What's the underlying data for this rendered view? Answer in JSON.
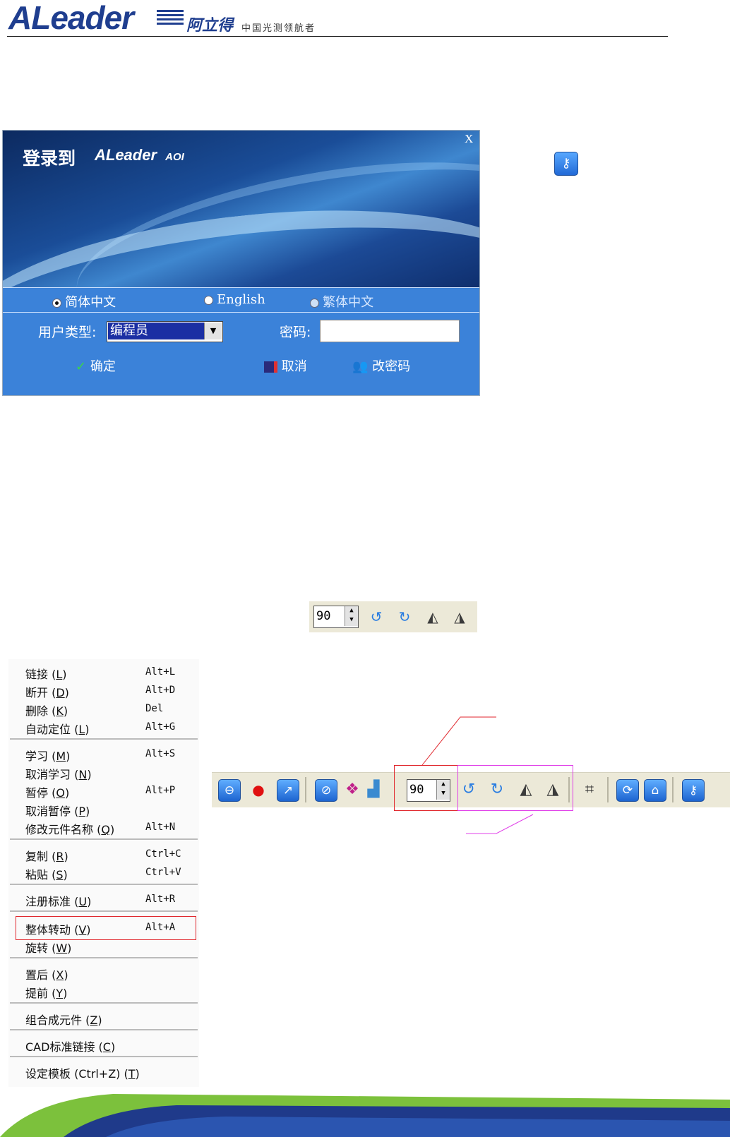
{
  "header": {
    "logo_text": "ALeader",
    "logo_cn": "阿立得",
    "tagline": "中国光测领航者"
  },
  "login_dialog": {
    "title": "登录到",
    "brand": "ALeader",
    "brand_suffix": "AOI",
    "close_label": "X",
    "languages": [
      {
        "label": "简体中文",
        "selected": true
      },
      {
        "label": "English",
        "selected": false
      },
      {
        "label": "繁体中文",
        "selected": false
      }
    ],
    "user_type_label": "用户类型:",
    "user_type_value": "编程员",
    "password_label": "密码:",
    "password_value": "",
    "ok_label": "确定",
    "cancel_label": "取消",
    "change_password_label": "改密码"
  },
  "small_toolbar": {
    "angle_value": "90"
  },
  "context_menu": {
    "items": [
      {
        "label": "链接",
        "key": "L",
        "shortcut": "Alt+L"
      },
      {
        "label": "断开",
        "key": "D",
        "shortcut": "Alt+D"
      },
      {
        "label": "删除",
        "key": "K",
        "shortcut": "Del"
      },
      {
        "label": "自动定位",
        "key": "L",
        "shortcut": "Alt+G"
      },
      {
        "label": "学习",
        "key": "M",
        "shortcut": "Alt+S"
      },
      {
        "label": "取消学习",
        "key": "N",
        "shortcut": ""
      },
      {
        "label": "暂停",
        "key": "O",
        "shortcut": "Alt+P"
      },
      {
        "label": "取消暂停",
        "key": "P",
        "shortcut": ""
      },
      {
        "label": "修改元件名称",
        "key": "Q",
        "shortcut": "Alt+N"
      },
      {
        "label": "复制",
        "key": "R",
        "shortcut": "Ctrl+C"
      },
      {
        "label": "粘贴",
        "key": "S",
        "shortcut": "Ctrl+V"
      },
      {
        "label": "注册标准",
        "key": "U",
        "shortcut": "Alt+R"
      },
      {
        "label": "整体转动",
        "key": "V",
        "shortcut": "Alt+A"
      },
      {
        "label": "旋转",
        "key": "W",
        "shortcut": ""
      },
      {
        "label": "置后",
        "key": "X",
        "shortcut": ""
      },
      {
        "label": "提前",
        "key": "Y",
        "shortcut": ""
      },
      {
        "label": "组合成元件",
        "key": "Z",
        "shortcut": ""
      },
      {
        "label": "CAD标准链接",
        "key": "C",
        "shortcut": ""
      },
      {
        "label": "设定模板 (Ctrl+Z)",
        "key": "T",
        "shortcut": ""
      }
    ]
  },
  "main_toolbar": {
    "angle_value": "90"
  },
  "colors": {
    "brand_blue": "#1f3e8f",
    "dialog_blue": "#3b82d9",
    "highlight_red": "#e0262c",
    "highlight_magenta": "#e040e8"
  }
}
